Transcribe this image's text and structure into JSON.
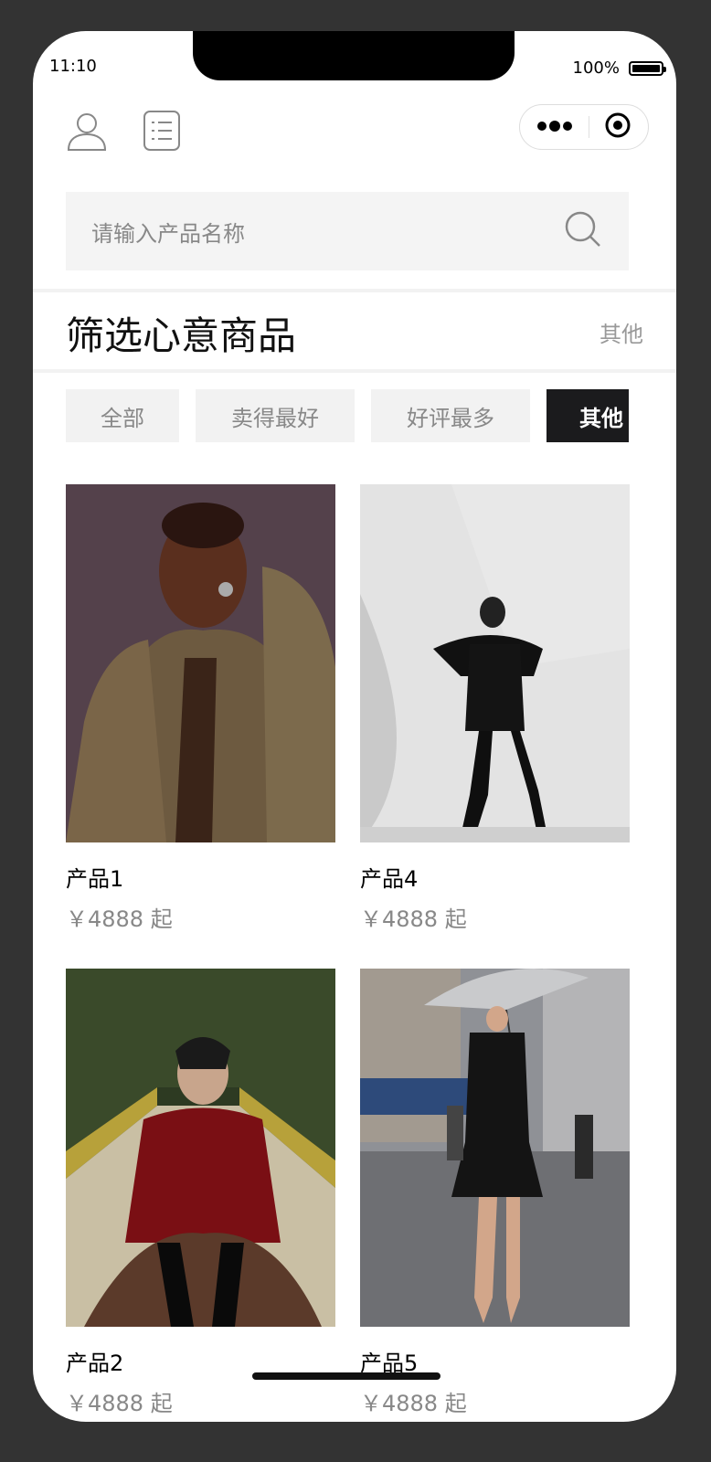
{
  "status": {
    "time": "11:10",
    "battery": "100%",
    "battery_level": 1.0
  },
  "search": {
    "placeholder": "请输入产品名称"
  },
  "section": {
    "title": "筛选心意商品",
    "more": "其他"
  },
  "tabs": [
    {
      "label": "全部",
      "active": false
    },
    {
      "label": "卖得最好",
      "active": false
    },
    {
      "label": "好评最多",
      "active": false
    },
    {
      "label": "其他",
      "active": true
    }
  ],
  "products": [
    {
      "name": "产品1",
      "price": "￥4888 起"
    },
    {
      "name": "产品4",
      "price": "￥4888 起"
    },
    {
      "name": "产品2",
      "price": "￥4888 起"
    },
    {
      "name": "产品5",
      "price": "￥4888 起"
    }
  ],
  "colors": {
    "active_tab": "#1b1b1d",
    "tab_bg": "#f2f2f2",
    "search_bg": "#f4f4f4"
  }
}
